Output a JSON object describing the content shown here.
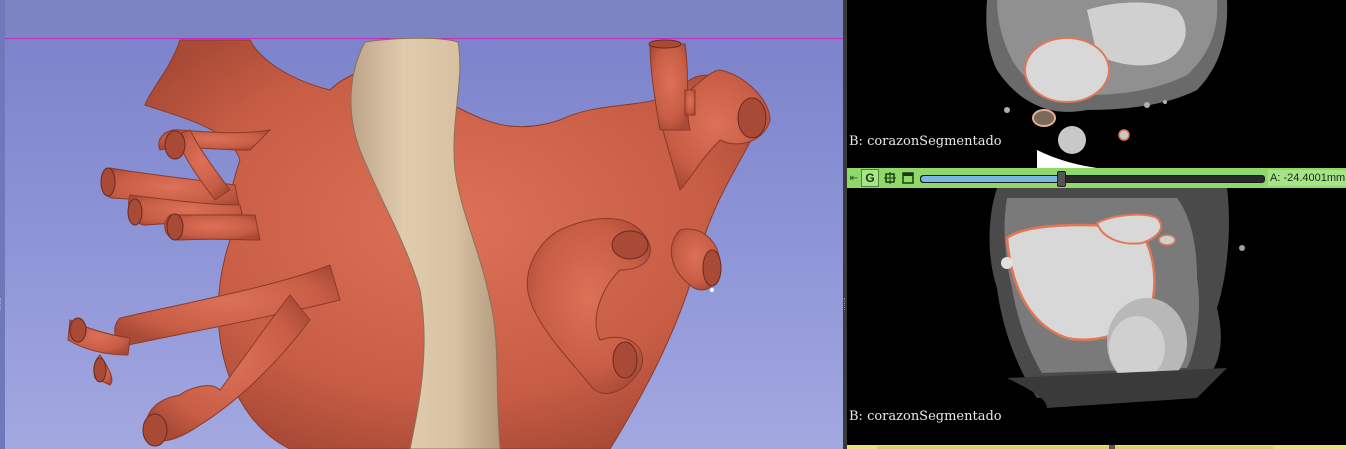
{
  "viewer_3d": {
    "name": "3D view",
    "background_top": "#7a80c8",
    "background_bottom": "#a3a8e0",
    "segments": [
      {
        "name": "heart-segment",
        "color": "#d0654c"
      },
      {
        "name": "aorta-segment",
        "color": "#d8c2a2"
      }
    ]
  },
  "slice_views": {
    "top": {
      "label": "B: corazonSegmentado",
      "outline_color": "#e07858"
    },
    "green": {
      "pin_icon": "pin-icon",
      "letter": "G",
      "link_icon": "link-icon",
      "window_icon": "window-icon",
      "offset": "A: -24.4001mm",
      "slider_fraction": 0.41,
      "color": "#8fd86a"
    },
    "bottom": {
      "label": "B: corazonSegmentado",
      "outline_color": "#e07858"
    },
    "yellow": {
      "color": "#e8e27a"
    }
  }
}
